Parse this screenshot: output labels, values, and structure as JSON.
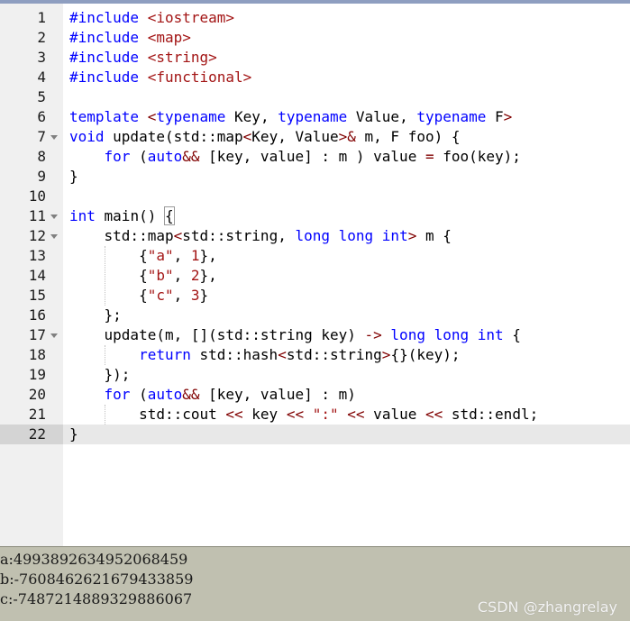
{
  "editor": {
    "current_line": 22,
    "lines": [
      {
        "n": "1",
        "fold": false,
        "tokens": [
          {
            "c": "pp",
            "t": "#include "
          },
          {
            "c": "inc",
            "t": "<iostream>"
          }
        ]
      },
      {
        "n": "2",
        "fold": false,
        "tokens": [
          {
            "c": "pp",
            "t": "#include "
          },
          {
            "c": "inc",
            "t": "<map>"
          }
        ]
      },
      {
        "n": "3",
        "fold": false,
        "tokens": [
          {
            "c": "pp",
            "t": "#include "
          },
          {
            "c": "inc",
            "t": "<string>"
          }
        ]
      },
      {
        "n": "4",
        "fold": false,
        "tokens": [
          {
            "c": "pp",
            "t": "#include "
          },
          {
            "c": "inc",
            "t": "<functional>"
          }
        ]
      },
      {
        "n": "5",
        "fold": false,
        "tokens": []
      },
      {
        "n": "6",
        "fold": false,
        "tokens": [
          {
            "c": "kw",
            "t": "template"
          },
          {
            "c": "",
            "t": " "
          },
          {
            "c": "op",
            "t": "<"
          },
          {
            "c": "kw",
            "t": "typename"
          },
          {
            "c": "",
            "t": " Key, "
          },
          {
            "c": "kw",
            "t": "typename"
          },
          {
            "c": "",
            "t": " Value, "
          },
          {
            "c": "kw",
            "t": "typename"
          },
          {
            "c": "",
            "t": " F"
          },
          {
            "c": "op",
            "t": ">"
          }
        ]
      },
      {
        "n": "7",
        "fold": true,
        "tokens": [
          {
            "c": "kw",
            "t": "void"
          },
          {
            "c": "",
            "t": " update(std::map"
          },
          {
            "c": "op",
            "t": "<"
          },
          {
            "c": "",
            "t": "Key, Value"
          },
          {
            "c": "op",
            "t": ">&"
          },
          {
            "c": "",
            "t": " m, F foo) {"
          }
        ]
      },
      {
        "n": "8",
        "fold": false,
        "tokens": [
          {
            "c": "",
            "t": "    "
          },
          {
            "c": "kw",
            "t": "for"
          },
          {
            "c": "",
            "t": " ("
          },
          {
            "c": "kw",
            "t": "auto"
          },
          {
            "c": "op",
            "t": "&&"
          },
          {
            "c": "",
            "t": " [key, value] : m ) value "
          },
          {
            "c": "op",
            "t": "="
          },
          {
            "c": "",
            "t": " foo(key);"
          }
        ]
      },
      {
        "n": "9",
        "fold": false,
        "tokens": [
          {
            "c": "",
            "t": "}"
          }
        ]
      },
      {
        "n": "10",
        "fold": false,
        "tokens": []
      },
      {
        "n": "11",
        "fold": true,
        "tokens": [
          {
            "c": "kw",
            "t": "int"
          },
          {
            "c": "",
            "t": " main() "
          },
          {
            "c": "brace-match",
            "t": "{"
          }
        ]
      },
      {
        "n": "12",
        "fold": true,
        "tokens": [
          {
            "c": "",
            "t": "    std::map"
          },
          {
            "c": "op",
            "t": "<"
          },
          {
            "c": "",
            "t": "std::string, "
          },
          {
            "c": "kw",
            "t": "long long int"
          },
          {
            "c": "op",
            "t": ">"
          },
          {
            "c": "",
            "t": " m {"
          }
        ]
      },
      {
        "n": "13",
        "fold": false,
        "tokens": [
          {
            "c": "",
            "t": "        {"
          },
          {
            "c": "str",
            "t": "\"a\""
          },
          {
            "c": "",
            "t": ", "
          },
          {
            "c": "str",
            "t": "1"
          },
          {
            "c": "",
            "t": "},"
          }
        ]
      },
      {
        "n": "14",
        "fold": false,
        "tokens": [
          {
            "c": "",
            "t": "        {"
          },
          {
            "c": "str",
            "t": "\"b\""
          },
          {
            "c": "",
            "t": ", "
          },
          {
            "c": "str",
            "t": "2"
          },
          {
            "c": "",
            "t": "},"
          }
        ]
      },
      {
        "n": "15",
        "fold": false,
        "tokens": [
          {
            "c": "",
            "t": "        {"
          },
          {
            "c": "str",
            "t": "\"c\""
          },
          {
            "c": "",
            "t": ", "
          },
          {
            "c": "str",
            "t": "3"
          },
          {
            "c": "",
            "t": "}"
          }
        ]
      },
      {
        "n": "16",
        "fold": false,
        "tokens": [
          {
            "c": "",
            "t": "    };"
          }
        ]
      },
      {
        "n": "17",
        "fold": true,
        "tokens": [
          {
            "c": "",
            "t": "    update(m, [](std::string key) "
          },
          {
            "c": "op",
            "t": "->"
          },
          {
            "c": "",
            "t": " "
          },
          {
            "c": "kw",
            "t": "long long int"
          },
          {
            "c": "",
            "t": " {"
          }
        ]
      },
      {
        "n": "18",
        "fold": false,
        "tokens": [
          {
            "c": "",
            "t": "        "
          },
          {
            "c": "kw",
            "t": "return"
          },
          {
            "c": "",
            "t": " std::hash"
          },
          {
            "c": "op",
            "t": "<"
          },
          {
            "c": "",
            "t": "std::string"
          },
          {
            "c": "op",
            "t": ">"
          },
          {
            "c": "",
            "t": "{}(key);"
          }
        ]
      },
      {
        "n": "19",
        "fold": false,
        "tokens": [
          {
            "c": "",
            "t": "    });"
          }
        ]
      },
      {
        "n": "20",
        "fold": false,
        "tokens": [
          {
            "c": "",
            "t": "    "
          },
          {
            "c": "kw",
            "t": "for"
          },
          {
            "c": "",
            "t": " ("
          },
          {
            "c": "kw",
            "t": "auto"
          },
          {
            "c": "op",
            "t": "&&"
          },
          {
            "c": "",
            "t": " [key, value] : m)"
          }
        ]
      },
      {
        "n": "21",
        "fold": false,
        "tokens": [
          {
            "c": "",
            "t": "        std::cout "
          },
          {
            "c": "op",
            "t": "<<"
          },
          {
            "c": "",
            "t": " key "
          },
          {
            "c": "op",
            "t": "<<"
          },
          {
            "c": "",
            "t": " "
          },
          {
            "c": "str",
            "t": "\":\""
          },
          {
            "c": "",
            "t": " "
          },
          {
            "c": "op",
            "t": "<<"
          },
          {
            "c": "",
            "t": " value "
          },
          {
            "c": "op",
            "t": "<<"
          },
          {
            "c": "",
            "t": " std::endl;"
          }
        ]
      },
      {
        "n": "22",
        "fold": false,
        "tokens": [
          {
            "c": "",
            "t": "}"
          }
        ]
      }
    ]
  },
  "console": {
    "lines": [
      "a:4993892634952068459",
      "b:-7608462621679433859",
      "c:-7487214889329886067"
    ]
  },
  "watermark": "CSDN @zhangrelay"
}
